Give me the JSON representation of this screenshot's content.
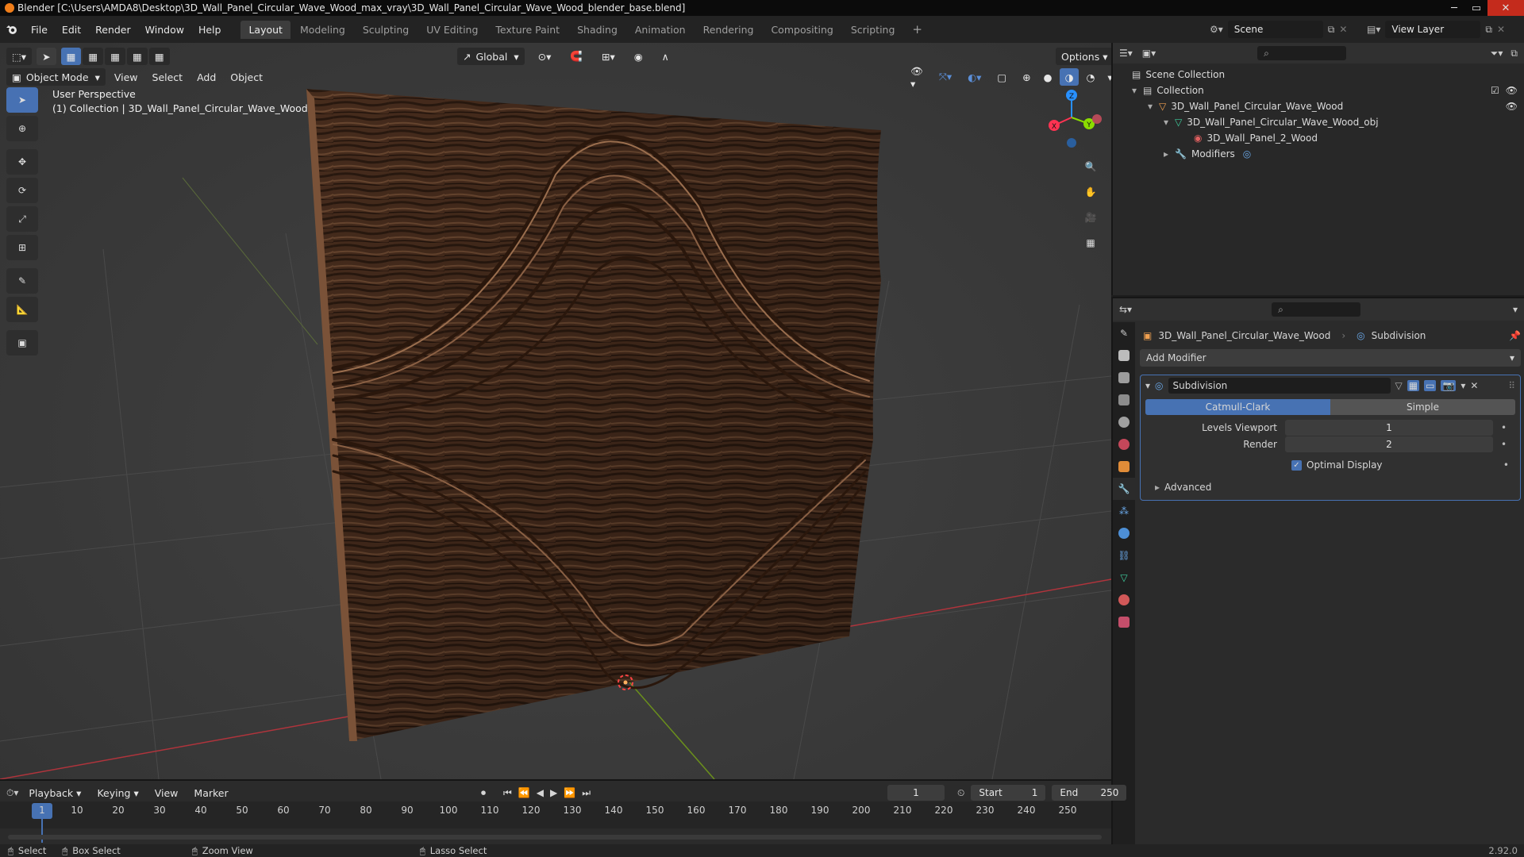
{
  "window": {
    "title": "Blender [C:\\Users\\AMDA8\\Desktop\\3D_Wall_Panel_Circular_Wave_Wood_max_vray\\3D_Wall_Panel_Circular_Wave_Wood_blender_base.blend]"
  },
  "menu": [
    "File",
    "Edit",
    "Render",
    "Window",
    "Help"
  ],
  "workspaces": [
    "Layout",
    "Modeling",
    "Sculpting",
    "UV Editing",
    "Texture Paint",
    "Shading",
    "Animation",
    "Rendering",
    "Compositing",
    "Scripting"
  ],
  "active_workspace": "Layout",
  "add_workspace": "+",
  "scene": {
    "name": "Scene",
    "view_layer": "View Layer"
  },
  "viewport": {
    "transform_orientation": "Global",
    "options_label": "Options",
    "mode": "Object Mode",
    "header_menus": [
      "View",
      "Select",
      "Add",
      "Object"
    ],
    "overlay_text_1": "User Perspective",
    "overlay_text_2": "(1) Collection | 3D_Wall_Panel_Circular_Wave_Wood",
    "gizmo_axes": {
      "x": "X",
      "y": "Y",
      "z": "Z"
    }
  },
  "outliner": {
    "items": [
      {
        "label": "Scene Collection",
        "level": 0
      },
      {
        "label": "Collection",
        "level": 1
      },
      {
        "label": "3D_Wall_Panel_Circular_Wave_Wood",
        "level": 2
      },
      {
        "label": "3D_Wall_Panel_Circular_Wave_Wood_obj",
        "level": 3
      },
      {
        "label": "3D_Wall_Panel_2_Wood",
        "level": 4
      },
      {
        "label": "Modifiers",
        "level": 3
      }
    ]
  },
  "properties": {
    "object_name": "3D_Wall_Panel_Circular_Wave_Wood",
    "modifier_crumb": "Subdivision",
    "add_modifier": "Add Modifier",
    "modifier": {
      "name": "Subdivision",
      "type_options": [
        "Catmull-Clark",
        "Simple"
      ],
      "selected_type": "Catmull-Clark",
      "levels_viewport_label": "Levels Viewport",
      "levels_viewport": "1",
      "render_label": "Render",
      "render": "2",
      "optimal_display_label": "Optimal Display",
      "optimal_display": true,
      "advanced_label": "Advanced"
    }
  },
  "timeline": {
    "menus": [
      "Playback",
      "Keying",
      "View",
      "Marker"
    ],
    "current_frame": "1",
    "start_label": "Start",
    "start": "1",
    "end_label": "End",
    "end": "250",
    "ticks": [
      "1",
      "10",
      "20",
      "30",
      "40",
      "50",
      "60",
      "70",
      "80",
      "90",
      "100",
      "110",
      "120",
      "130",
      "140",
      "150",
      "160",
      "170",
      "180",
      "190",
      "200",
      "210",
      "220",
      "230",
      "240",
      "250"
    ]
  },
  "statusbar": {
    "items": [
      "Select",
      "Box Select",
      "Zoom View",
      "Lasso Select"
    ],
    "version": "2.92.0"
  },
  "colors": {
    "accent_blue": "#4772b3",
    "wood_dark": "#3a2418",
    "wood_light": "#6b4a34",
    "axis_red": "#ff3352",
    "axis_green": "#8bdc00",
    "axis_blue": "#2890ff"
  }
}
